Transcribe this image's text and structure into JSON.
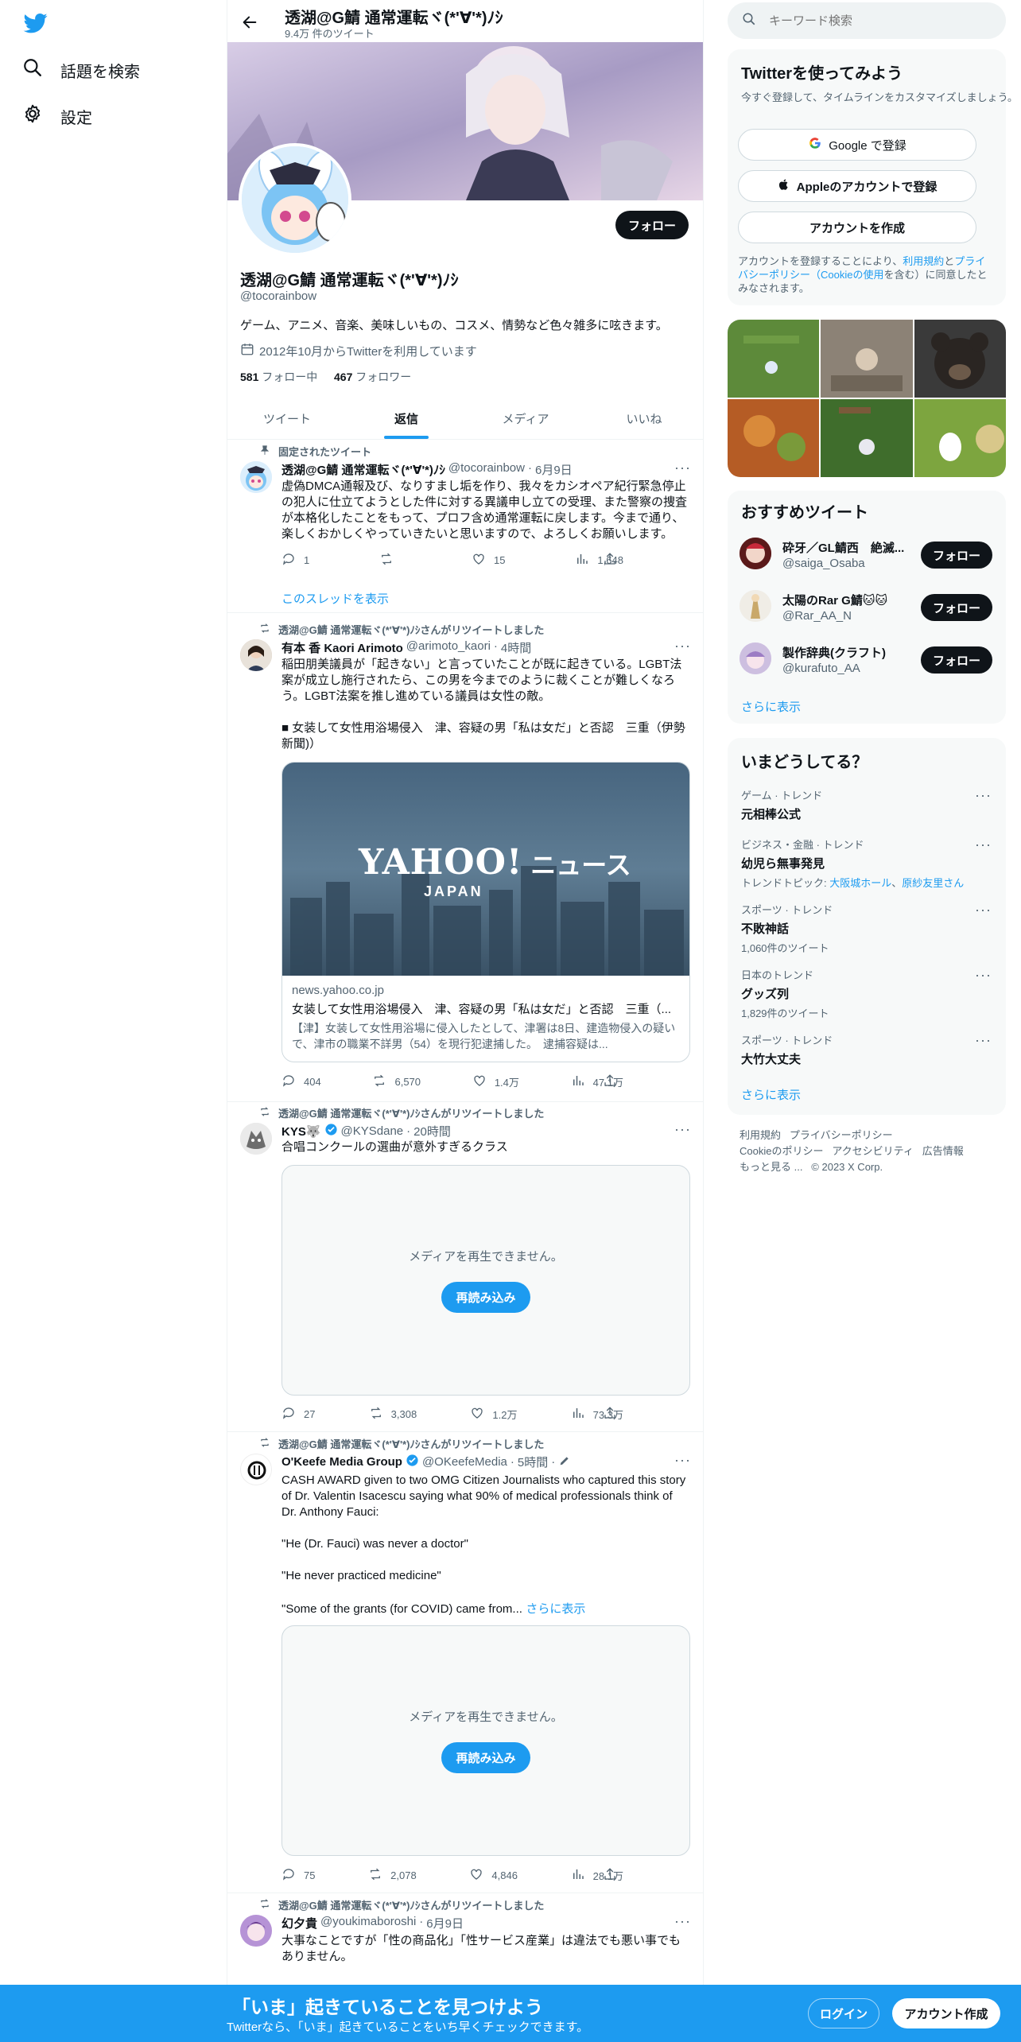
{
  "left_nav": {
    "search_label": "話題を検索",
    "settings_label": "設定"
  },
  "header": {
    "name": "透湖@G鯖 通常運転ヾ(*'∀'*)ﾉｼ",
    "tweet_count": "9.4万 件のツイート"
  },
  "profile": {
    "name": "透湖@G鯖 通常運転ヾ(*'∀'*)ﾉｼ",
    "handle": "@tocorainbow",
    "bio": "ゲーム、アニメ、音楽、美味しいもの、コスメ、情勢など色々雑多に呟きます。",
    "joined": "2012年10月からTwitterを利用しています",
    "following_count": "581",
    "following_label": "フォロー中",
    "followers_count": "467",
    "followers_label": "フォロワー",
    "follow_button": "フォロー"
  },
  "tabs": [
    {
      "label": "ツイート",
      "active": false
    },
    {
      "label": "返信",
      "active": true
    },
    {
      "label": "メディア",
      "active": false
    },
    {
      "label": "いいね",
      "active": false
    }
  ],
  "pinned": {
    "label": "固定されたツイート",
    "name": "透湖@G鯖 通常運転ヾ(*'∀'*)ﾉｼ",
    "handle": "@tocorainbow",
    "time": "6月9日",
    "text": "虚偽DMCA通報及び、なりすまし垢を作り、我々をカシオペア紀行緊急停止の犯人に仕立てようとした件に対する異議申し立ての受理、また警察の捜査が本格化したことをもって、プロフ含め通常運転に戻します。今まで通り、楽しくおかしくやっていきたいと思いますので、よろしくお願いします。",
    "replies": "1",
    "retweets": "",
    "likes": "15",
    "views": "1,648",
    "thread_link": "このスレッドを表示"
  },
  "tweets": [
    {
      "retweeted_by": "透湖@G鯖 通常運転ヾ(*'∀'*)ﾉｼさんがリツイートしました",
      "name": "有本 香 Kaori Arimoto",
      "handle": "@arimoto_kaori",
      "time": "4時間",
      "text": "稲田朋美議員が「起きない」と言っていたことが既に起きている。LGBT法案が成立し施行されたら、この男を今までのように裁くことが難しくなろう。LGBT法案を推し進めている議員は女性の敵。\n\n■ 女装して女性用浴場侵入　津、容疑の男「私は女だ」と否認　三重（伊勢新聞)）",
      "card": {
        "logo_main": "YAHOO!",
        "logo_sub": "JAPAN",
        "logo_suffix": "ニュース",
        "domain": "news.yahoo.co.jp",
        "title": "女装して女性用浴場侵入　津、容疑の男「私は女だ」と否認　三重（...",
        "desc": "【津】女装して女性用浴場に侵入したとして、津署は8日、建造物侵入の疑いで、津市の職業不詳男（54）を現行犯逮捕した。　逮捕容疑は..."
      },
      "replies": "404",
      "retweets": "6,570",
      "likes": "1.4万",
      "views": "47.1万"
    },
    {
      "retweeted_by": "透湖@G鯖 通常運転ヾ(*'∀'*)ﾉｼさんがリツイートしました",
      "name": "KYS🐺",
      "handle": "@KYSdane",
      "time": "20時間",
      "text": "合唱コンクールの選曲が意外すぎるクラス",
      "media_error": "メディアを再生できません。",
      "reload": "再読み込み",
      "replies": "27",
      "retweets": "3,308",
      "likes": "1.2万",
      "views": "73.3万"
    },
    {
      "retweeted_by": "透湖@G鯖 通常運転ヾ(*'∀'*)ﾉｼさんがリツイートしました",
      "name": "O'Keefe Media Group",
      "handle": "@OKeefeMedia",
      "time": "5時間",
      "text": "CASH AWARD given to two OMG Citizen Journalists who captured this story of Dr. Valentin Isacescu saying what 90% of medical professionals think of Dr. Anthony Fauci:\n\n\"He (Dr. Fauci) was never a doctor\"\n\n\"He never practiced medicine\"\n\n\"Some of the grants (for COVID) came from...",
      "more": "さらに表示",
      "media_error": "メディアを再生できません。",
      "reload": "再読み込み",
      "replies": "75",
      "retweets": "2,078",
      "likes": "4,846",
      "views": "28.1万"
    },
    {
      "retweeted_by": "透湖@G鯖 通常運転ヾ(*'∀'*)ﾉｼさんがリツイートしました",
      "name": "幻夕貴",
      "handle": "@youkimaboroshi",
      "time": "6月9日",
      "text": "大事なことですが「性の商品化」「性サービス産業」は違法でも悪い事でもありません。"
    }
  ],
  "search": {
    "placeholder": "キーワード検索"
  },
  "signup": {
    "title": "Twitterを使ってみよう",
    "subtitle": "今すぐ登録して、タイムラインをカスタマイズしましょう。",
    "google": "Google で登録",
    "apple": "Appleのアカウントで登録",
    "create": "アカウントを作成",
    "legal_pre": "アカウントを登録することにより、",
    "legal_terms": "利用規約",
    "legal_and": "と",
    "legal_privacy": "プライバシーポリシー（Cookieの使用",
    "legal_post": "を含む）に同意したとみなされます。"
  },
  "recommend": {
    "title": "おすすめツイート",
    "users": [
      {
        "name": "砕牙／GL鯖西　絶滅...",
        "handle": "@saiga_Osaba",
        "follow": "フォロー"
      },
      {
        "name": "太陽のRar G鯖🐱🐱",
        "handle": "@Rar_AA_N",
        "follow": "フォロー"
      },
      {
        "name": "製作辞典(クラフト)",
        "handle": "@kurafuto_AA",
        "follow": "フォロー"
      }
    ],
    "more": "さらに表示"
  },
  "trends": {
    "title": "いまどうしてる？",
    "items": [
      {
        "category": "ゲーム · トレンド",
        "name": "元相棒公式",
        "meta": ""
      },
      {
        "category": "ビジネス・金融 · トレンド",
        "name": "幼児ら無事発見",
        "topic_label": "トレンドトピック:",
        "topic_1": "大阪城ホール",
        "topic_2": "原紗友里さん"
      },
      {
        "category": "スポーツ · トレンド",
        "name": "不敗神話",
        "meta": "1,060件のツイート"
      },
      {
        "category": "日本のトレンド",
        "name": "グッズ列",
        "meta": "1,829件のツイート"
      },
      {
        "category": "スポーツ · トレンド",
        "name": "大竹大丈夫",
        "meta": ""
      }
    ],
    "more": "さらに表示"
  },
  "footer": {
    "links": [
      "利用規約",
      "プライバシーポリシー",
      "Cookieのポリシー",
      "アクセシビリティ",
      "広告情報",
      "もっと見る ...",
      "© 2023 X Corp."
    ]
  },
  "banner": {
    "title": "「いま」起きていることを見つけよう",
    "subtitle": "Twitterなら、「いま」起きていることをいち早くチェックできます。",
    "login": "ログイン",
    "signup": "アカウント作成"
  },
  "colors": {
    "accent": "#1d9bf0",
    "banner_bg": "#1d9bf0",
    "text": "#0f1419",
    "muted": "#536471"
  }
}
